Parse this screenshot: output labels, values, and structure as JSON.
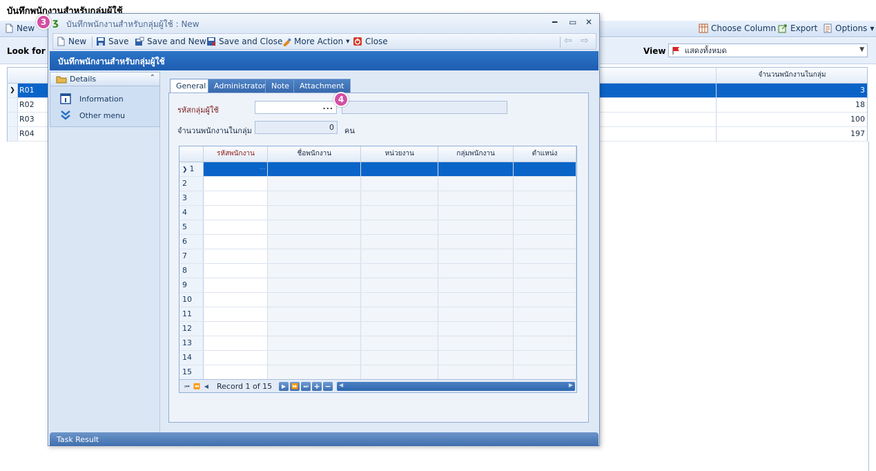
{
  "background": {
    "title": "บันทึกพนักงานสำหรับกลุ่มผู้ใช้",
    "toolbar": {
      "new_label": "New",
      "choose_column_label": "Choose Column",
      "export_label": "Export",
      "options_label": "Options"
    },
    "filter": {
      "look_for_label": "Look for",
      "view_label": "View",
      "view_value": "แสดงทั้งหมด"
    },
    "grid": {
      "last_column_header": "จำนวนพนักงานในกลุ่ม",
      "rows": [
        {
          "code": "R01",
          "count": "3"
        },
        {
          "code": "R02",
          "count": "18"
        },
        {
          "code": "R03",
          "count": "100"
        },
        {
          "code": "R04",
          "count": "197"
        }
      ]
    }
  },
  "dialog": {
    "title": "บันทึกพนักงานสำหรับกลุ่มผู้ใช้ : New",
    "header": "บันทึกพนักงานสำหรับกลุ่มผู้ใช้",
    "toolbar": {
      "new_label": "New",
      "save_label": "Save",
      "save_new_label": "Save and New",
      "save_close_label": "Save and Close",
      "more_action_label": "More Action",
      "close_label": "Close"
    },
    "sidebar": {
      "panel_title": "Details",
      "items": [
        {
          "label": "Information"
        },
        {
          "label": "Other menu"
        }
      ]
    },
    "tabs": [
      {
        "label": "General"
      },
      {
        "label": "Administrator"
      },
      {
        "label": "Note"
      },
      {
        "label": "Attachment"
      }
    ],
    "form": {
      "group_code_label": "รหัสกลุ่มผู้ใช้",
      "group_code_value": "",
      "ellipsis": "...",
      "group_name_value": "",
      "employee_count_label": "จำนวนพนักงานในกลุ่ม",
      "employee_count_value": "0",
      "employee_count_unit": "คน"
    },
    "grid": {
      "columns": [
        "รหัสพนักงาน",
        "ชื่อพนักงาน",
        "หน่วยงาน",
        "กลุ่มพนักงาน",
        "ตำแหน่ง"
      ],
      "row_numbers": [
        "1",
        "2",
        "3",
        "4",
        "5",
        "6",
        "7",
        "8",
        "9",
        "10",
        "11",
        "12",
        "13",
        "14",
        "15"
      ],
      "record_text": "Record 1 of 15"
    },
    "task_result_label": "Task Result"
  },
  "badges": {
    "step3": "3",
    "step4": "4"
  },
  "colors": {
    "accent": "#1e5db1",
    "selection": "#0a64c8",
    "badge": "#d44ea3"
  }
}
